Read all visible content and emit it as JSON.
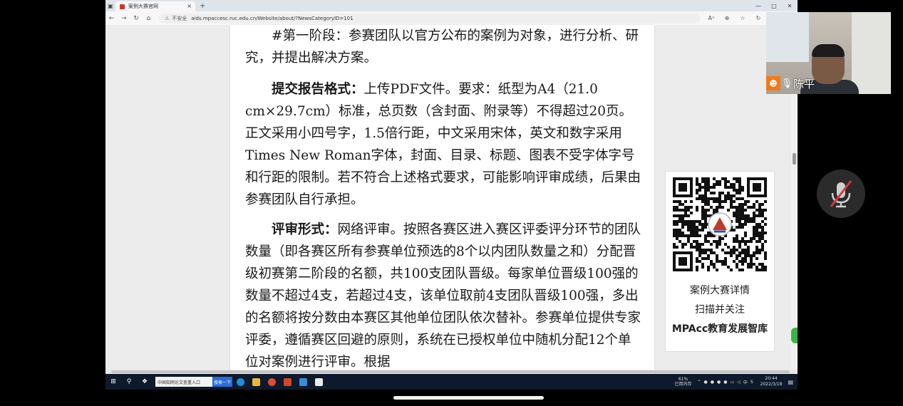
{
  "browser": {
    "tab_title": "案例大赛官网",
    "tab_close": "×",
    "new_tab": "+",
    "window_controls": [
      "—",
      "□",
      "✕"
    ],
    "security_label": "不安全",
    "url": "aids.mpaccesc.ruc.edu.cn/Website/about/?NewsCategoryID=101",
    "addr_icons": [
      "Aᴬ",
      "⊕",
      "☆",
      "↻",
      "✩",
      "⧉"
    ]
  },
  "document": {
    "paragraphs": [
      {
        "bold": "",
        "text": "#第一阶段：参赛团队以官方公布的案例为对象，进行分析、研究，并提出解决方案。"
      },
      {
        "bold": "提交报告格式：",
        "text": "上传PDF文件。要求：纸型为A4（21.0　cm×29.7cm）标准，总页数（含封面、附录等）不得超过20页。正文采用小四号字，1.5倍行距，中文采用宋体，英文和数字采用Times New Roman字体，封面、目录、标题、图表不受字体字号和行距的限制。若不符合上述格式要求，可能影响评审成绩，后果由参赛团队自行承担。"
      },
      {
        "bold": "评审形式：",
        "text": "网络评审。按照各赛区进入赛区评委评分环节的团队数量（即各赛区所有参赛单位预选的8个以内团队数量之和）分配晋级初赛第二阶段的名额，共100支团队晋级。每家单位晋级100强的数量不超过4支，若超过4支，该单位取前4支团队晋级100强，多出的名额将按分数由本赛区其他单位团队依次替补。参赛单位提供专家评委，遵循赛区回避的原则，系统在已授权单位中随机分配12个单位对案例进行评审。根据"
      }
    ]
  },
  "qr_card": {
    "line1": "案例大赛详情",
    "line2": "扫描并关注",
    "line3": "MPAcc教育发展智库"
  },
  "taskbar": {
    "search_text": "中国知网论文查重入口",
    "search_button": "搜索一下",
    "memory_percent": "61%",
    "memory_label": "已用内存",
    "ime": "中",
    "time": "20:44",
    "date": "2022/3/18"
  },
  "video": {
    "participant_name": "陈平"
  },
  "colors": {
    "taskbar": "#0e1a2b",
    "badge": "#f07a1a",
    "mute": "#d23b3b"
  }
}
